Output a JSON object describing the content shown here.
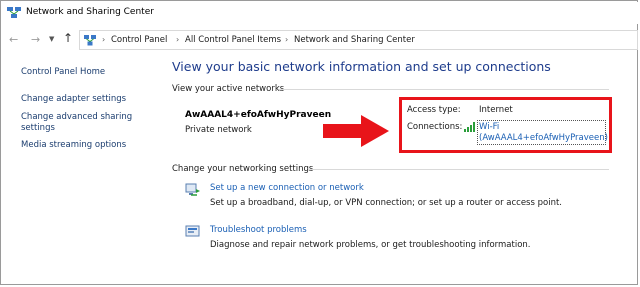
{
  "window": {
    "title": "Network and Sharing Center"
  },
  "address": {
    "back_icon": "back-arrow-icon",
    "forward_icon": "forward-arrow-icon",
    "up_icon": "up-arrow-icon",
    "breadcrumbs": [
      "Control Panel",
      "All Control Panel Items",
      "Network and Sharing Center"
    ]
  },
  "sidebar": {
    "items": [
      {
        "label": "Control Panel Home"
      },
      {
        "label": "Change adapter settings"
      },
      {
        "label": "Change advanced sharing settings"
      },
      {
        "label": "Media streaming options"
      }
    ]
  },
  "main": {
    "heading": "View your basic network information and set up connections",
    "active_networks_title": "View your active networks",
    "network": {
      "name": "AwAAAL4+efoAfwHyPraveen",
      "type": "Private network",
      "access_type_label": "Access type:",
      "access_type_value": "Internet",
      "connections_label": "Connections:",
      "connection_line1": "Wi-Fi",
      "connection_line2": "(AwAAAL4+efoAfwHyPraveen)"
    },
    "settings_title": "Change your networking settings",
    "actions": [
      {
        "link": "Set up a new connection or network",
        "desc": "Set up a broadband, dial-up, or VPN connection; or set up a router or access point."
      },
      {
        "link": "Troubleshoot problems",
        "desc": "Diagnose and repair network problems, or get troubleshooting information."
      }
    ]
  },
  "colors": {
    "highlight_box": "#e8141a",
    "arrow": "#e8141a",
    "link": "#1a5fb4",
    "heading": "#1e3c8c"
  }
}
